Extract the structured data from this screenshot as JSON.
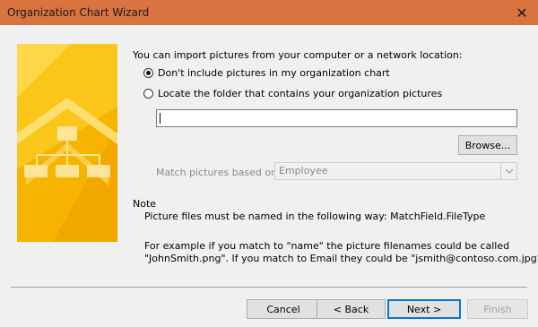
{
  "window": {
    "title": "Organization Chart Wizard",
    "close_glyph": "✕",
    "titlebar_color": "#d9733f"
  },
  "intro": "You can import pictures from your computer or a network location:",
  "options": [
    {
      "label": "Don't include pictures in my organization chart",
      "checked": true
    },
    {
      "label": "Locate the folder that contains your organization pictures",
      "checked": false
    }
  ],
  "folder_input": {
    "value": "",
    "placeholder": ""
  },
  "browse_label": "Browse...",
  "match": {
    "label": "Match pictures based on:",
    "selected": "Employee",
    "icon": "chevron-down-icon"
  },
  "note": {
    "title": "Note",
    "line1": "Picture files must be named in the following way: MatchField.FileType",
    "line2": "For example if you match to \"name\" the picture filenames could be called",
    "line3": "\"JohnSmith.png\". If you match to Email they could be \"jsmith@contoso.com.jpg\"."
  },
  "buttons": {
    "cancel": "Cancel",
    "back": "< Back",
    "next": "Next >",
    "finish": "Finish"
  },
  "graphic": {
    "colors": [
      "#f7b500",
      "#fcd53a",
      "#ffe77a"
    ]
  }
}
